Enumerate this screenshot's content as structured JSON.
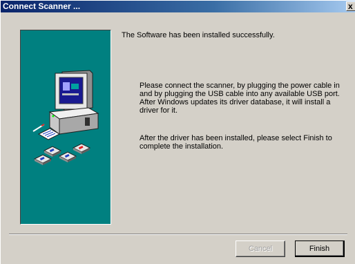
{
  "window": {
    "title": "Connect Scanner ...",
    "close_glyph": "x"
  },
  "content": {
    "heading": "The Software has been installed successfully.",
    "paragraph1": "Please connect the scanner, by plugging the power cable in and by plugging the USB cable into any available USB port. After Windows updates its driver database, it will install a driver for it.",
    "paragraph2": "After the driver has been installed, please select Finish to complete the installation."
  },
  "buttons": {
    "cancel": "Cancel",
    "finish": "Finish"
  },
  "colors": {
    "panel": "#008080",
    "titlebar_start": "#0a246a",
    "face": "#d4d0c8"
  },
  "illustration": {
    "icons": [
      "computer-icon",
      "monitor-icon",
      "document-icon",
      "floppy-disk-icon"
    ]
  }
}
